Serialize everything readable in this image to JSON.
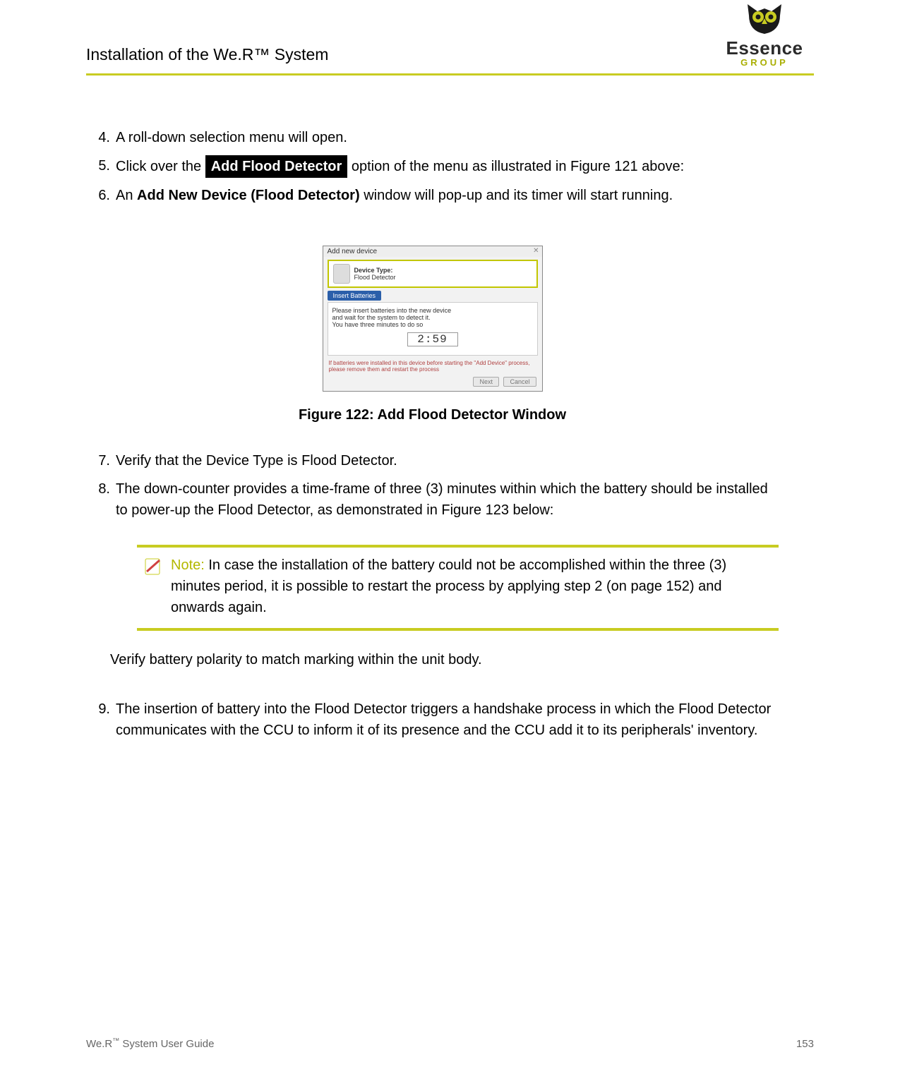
{
  "header": {
    "title": "Installation of the We.R™ System"
  },
  "logo": {
    "brand": "Essence",
    "sub": "GROUP"
  },
  "steps": {
    "s4": {
      "num": "4.",
      "text": "A roll-down selection menu will open."
    },
    "s5": {
      "num": "5.",
      "pre": "Click over the ",
      "button": "Add Flood Detector",
      "post": " option of the menu as illustrated in Figure 121 above:"
    },
    "s6": {
      "num": "6.",
      "pre": "An ",
      "bold": "Add New Device (Flood Detector)",
      "post": " window will pop-up and its timer will start running."
    },
    "s7": {
      "num": "7.",
      "text": "Verify that the Device Type is Flood Detector."
    },
    "s8": {
      "num": "8.",
      "text": "The down-counter provides a time-frame of three (3) minutes within which the battery should be installed to power-up the Flood Detector, as demonstrated in Figure 123 below:"
    },
    "s9": {
      "num": "9.",
      "text": "The insertion of battery into the Flood Detector triggers a handshake process in which the Flood Detector communicates with the CCU to inform it of its presence and the CCU add it to its peripherals' inventory."
    }
  },
  "figure": {
    "caption": "Figure 122: Add Flood Detector Window"
  },
  "dialog": {
    "title": "Add new device",
    "device_type_label": "Device Type:",
    "device_type_value": "Flood Detector",
    "tab": "Insert Batteries",
    "line1": "Please insert batteries into the new device",
    "line2": "and wait for the system to detect it.",
    "line3": "You have three minutes to do so",
    "timer": "2:59",
    "warn": "If batteries were installed in this device before starting the \"Add Device\" process, please remove them and restart the process",
    "next": "Next",
    "cancel": "Cancel"
  },
  "note": {
    "label": "Note:",
    "text": " In case the installation of the battery could not be accomplished within the three (3) minutes period, it is possible to restart the process by applying step 2 (on page 152) and onwards again."
  },
  "post_note": "Verify battery polarity to match marking within the unit body.",
  "footer": {
    "left_a": "We.R",
    "left_b": " System User Guide",
    "page": "153"
  }
}
